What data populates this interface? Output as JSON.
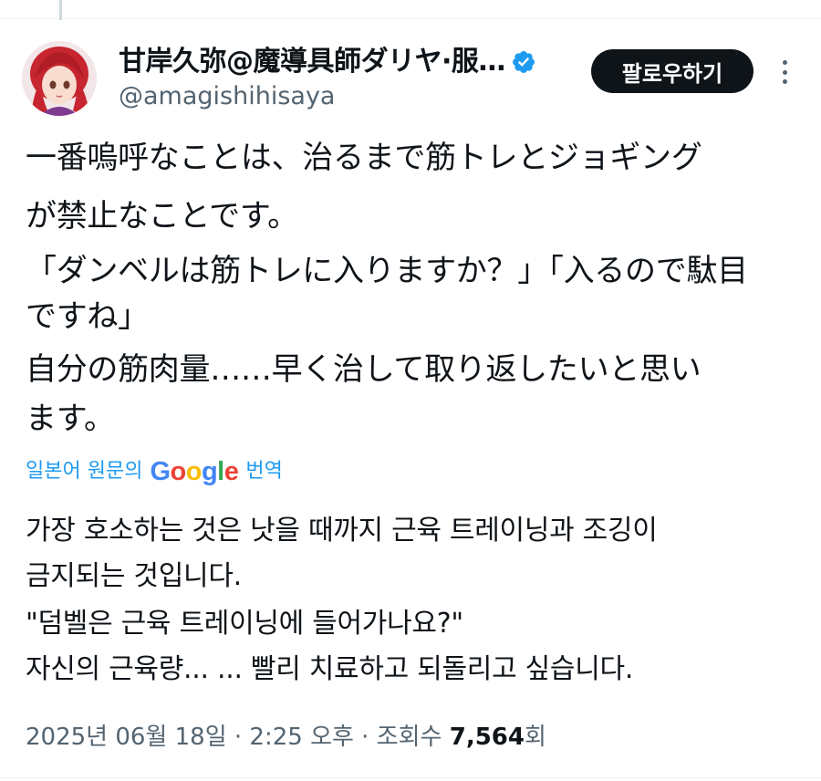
{
  "tweet": {
    "display_name": "甘岸久弥@魔導具師ダリヤ·服…",
    "handle": "@amagishihisaya",
    "follow_label": "팔로우하기",
    "original_lines": [
      "一番嗚呼なことは、治るまで筋トレとジョギング",
      "が禁止なことです。",
      "「ダンベルは筋トレに入りますか？」「入るので駄目",
      "ですね」",
      "自分の筋肉量……早く治して取り返したいと思い",
      "ます。"
    ],
    "translation": {
      "prefix": "일본어 원문의",
      "google_parts": [
        "G",
        "o",
        "o",
        "g",
        "l",
        "e"
      ],
      "suffix": "번역"
    },
    "translated_lines": [
      "가장 호소하는 것은 낫을 때까지 근육 트레이닝과 조깅이",
      "금지되는 것입니다.",
      "\"덤벨은 근육 트레이닝에 들어가나요?\"",
      "자신의 근육량... ... 빨리 치료하고 되돌리고 싶습니다."
    ],
    "meta": {
      "datetime": "2025년 06월 18일 · 2:25 오후 · 조회수 ",
      "views": "7,564",
      "views_suffix": "회"
    }
  },
  "icons": {
    "verified": "verified-badge-icon",
    "more": "more-options-icon",
    "verified_color": "#1d9bf0",
    "link_color": "#1d9bf0"
  }
}
